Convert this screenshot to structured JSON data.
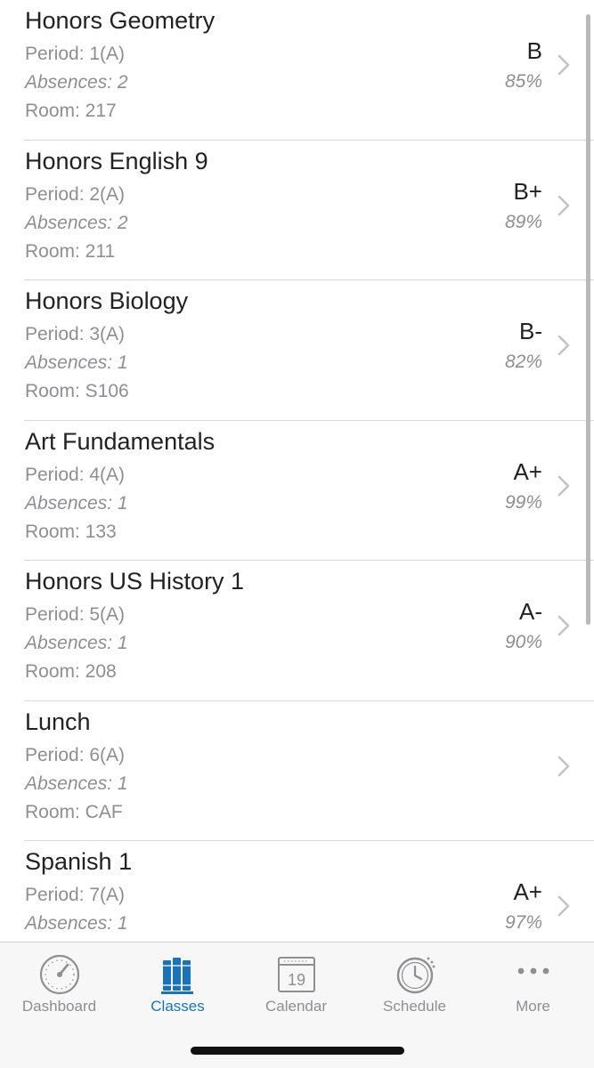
{
  "classes": [
    {
      "name": "Honors Geometry",
      "period": "Period: 1(A)",
      "absences": "Absences: 2",
      "room": "Room: 217",
      "grade": "B",
      "percent": "85%"
    },
    {
      "name": "Honors English 9",
      "period": "Period: 2(A)",
      "absences": "Absences: 2",
      "room": "Room: 211",
      "grade": "B+",
      "percent": "89%"
    },
    {
      "name": "Honors Biology",
      "period": "Period: 3(A)",
      "absences": "Absences: 1",
      "room": "Room: S106",
      "grade": "B-",
      "percent": "82%"
    },
    {
      "name": "Art Fundamentals",
      "period": "Period: 4(A)",
      "absences": "Absences: 1",
      "room": "Room: 133",
      "grade": "A+",
      "percent": "99%"
    },
    {
      "name": "Honors US History 1",
      "period": "Period: 5(A)",
      "absences": "Absences: 1",
      "room": "Room: 208",
      "grade": "A-",
      "percent": "90%"
    },
    {
      "name": "Lunch",
      "period": "Period: 6(A)",
      "absences": "Absences: 1",
      "room": "Room: CAF",
      "grade": "",
      "percent": ""
    },
    {
      "name": "Spanish 1",
      "period": "Period: 7(A)",
      "absences": "Absences: 1",
      "room": "",
      "grade": "A+",
      "percent": "97%"
    }
  ],
  "tabbar": {
    "tabs": [
      {
        "label": "Dashboard",
        "icon": "gauge-icon",
        "active": false
      },
      {
        "label": "Classes",
        "icon": "books-icon",
        "active": true
      },
      {
        "label": "Calendar",
        "icon": "calendar-icon",
        "active": false,
        "icon_text": "19"
      },
      {
        "label": "Schedule",
        "icon": "clock-icon",
        "active": false
      },
      {
        "label": "More",
        "icon": "more-dots-icon",
        "active": false
      }
    ]
  },
  "colors": {
    "accent": "#1a73b8",
    "inactive": "#8e8e93",
    "text": "#222222",
    "separator": "#d9d9d9"
  }
}
